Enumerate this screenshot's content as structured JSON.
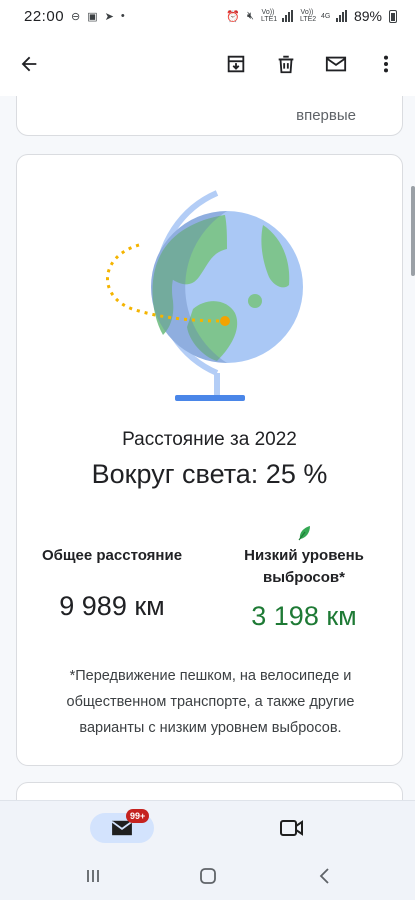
{
  "status_bar": {
    "time": "22:00",
    "battery_text": "89%",
    "net1": "Vo)) LTE1",
    "net2": "Vo)) LTE2",
    "net3": "4G"
  },
  "toolbar": {
    "back_icon": "arrow-back-icon",
    "archive_icon": "archive-icon",
    "delete_icon": "trash-icon",
    "mail_icon": "mail-icon",
    "more_icon": "more-vert-icon"
  },
  "prev_card": {
    "tail_text": "впервые"
  },
  "distance_card": {
    "title": "Расстояние за 2022",
    "value": "Вокруг света: 25 %",
    "around_world_fraction": 0.25,
    "total_label": "Общее расстояние",
    "total_value": "9 989 км",
    "low_label": "Низкий уровень выбросов*",
    "low_value": "3 198 км",
    "footnote": "*Передвижение пешком, на велосипеде и общественном транспорте, а также другие варианты с низким уровнем выбросов."
  },
  "bottom_nav": {
    "mail_badge": "99+"
  },
  "colors": {
    "accent_green": "#1e7a35",
    "badge_red": "#c5221f",
    "nav_pill": "#d3e3fd"
  }
}
